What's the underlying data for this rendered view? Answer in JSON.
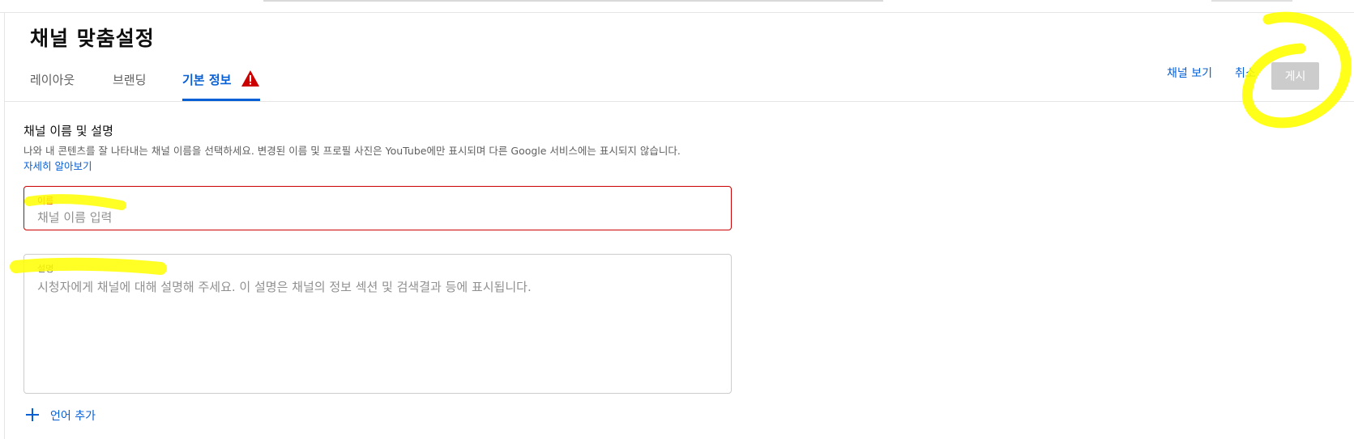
{
  "page": {
    "title": "채널 맞춤설정"
  },
  "tabs": [
    {
      "label": "레이아웃",
      "active": false
    },
    {
      "label": "브랜딩",
      "active": false
    },
    {
      "label": "기본 정보",
      "active": true,
      "warning": true
    }
  ],
  "header_actions": {
    "view_channel": "채널 보기",
    "cancel": "취소",
    "publish": "게시"
  },
  "section": {
    "title": "채널 이름 및 설명",
    "description": "나와 내 콘텐츠를 잘 나타내는 채널 이름을 선택하세요. 변경된 이름 및 프로필 사진은 YouTube에만 표시되며 다른 Google 서비스에는 표시되지 않습니다.",
    "learn_more": "자세히 알아보기"
  },
  "name_field": {
    "label": "이름",
    "placeholder": "채널 이름 입력",
    "value": "",
    "state": "error"
  },
  "description_field": {
    "label": "설명",
    "placeholder": "시청자에게 채널에 대해 설명해 주세요. 이 설명은 채널의 정보 섹션 및 검색결과 등에 표시됩니다.",
    "value": ""
  },
  "add_language": {
    "label": "언어 추가"
  },
  "icons": {
    "warning": "warning-triangle-icon",
    "add": "plus-icon"
  },
  "colors": {
    "accent": "#065fd4",
    "error": "#cc0000",
    "warning_icon": "#cc0000",
    "publish_disabled_bg": "#cccccc",
    "annotation": "#ffff00"
  }
}
